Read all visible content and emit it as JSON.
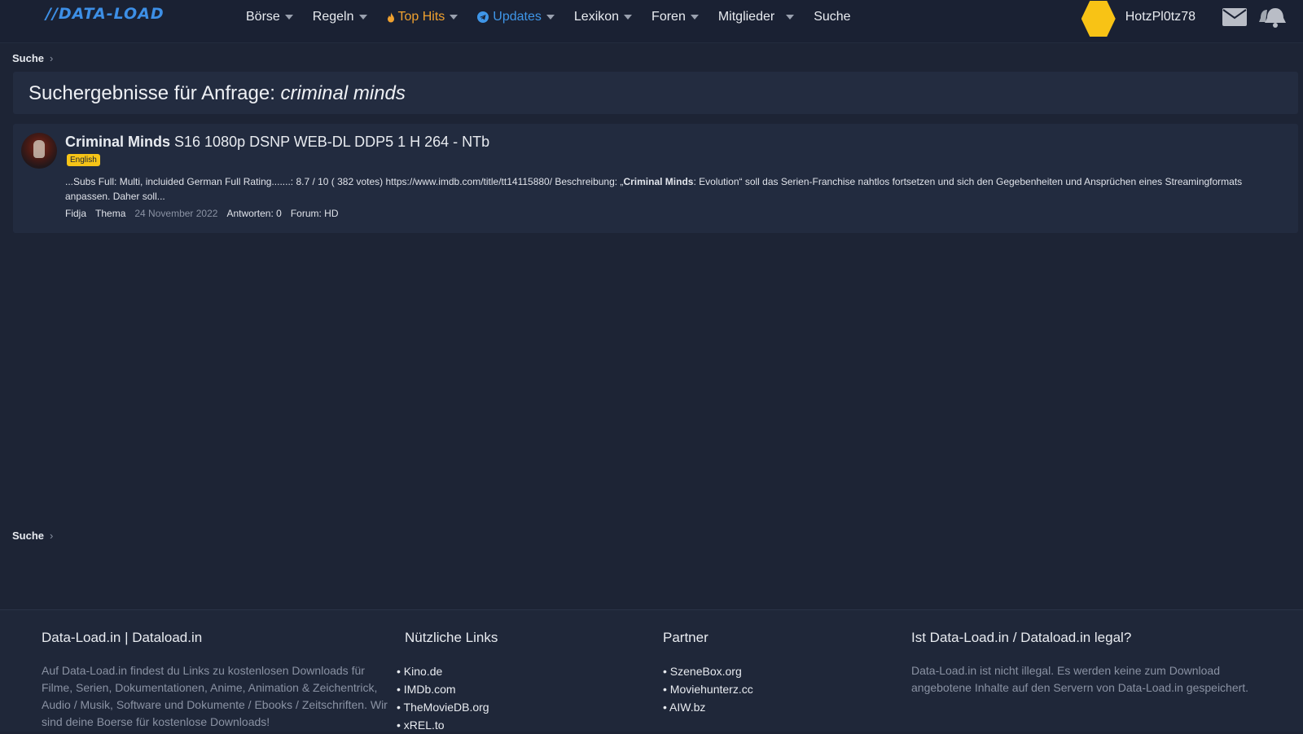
{
  "header": {
    "logo": "//DATA-LOAD",
    "nav": {
      "boerse": "Börse",
      "regeln": "Regeln",
      "top_hits": "Top Hits",
      "updates": "Updates",
      "lexikon": "Lexikon",
      "foren": "Foren",
      "mitglieder": "Mitglieder",
      "suche": "Suche"
    },
    "username": "HotzPl0tz78",
    "colors": {
      "top_hits": "#f0a12f",
      "updates": "#3f96e8",
      "avatar": "#f8c315"
    }
  },
  "breadcrumb": {
    "item": "Suche"
  },
  "search": {
    "prefix": "Suchergebnisse für Anfrage: ",
    "query": "criminal minds"
  },
  "result": {
    "title_bold": "Criminal Minds",
    "title_rest": " S16 1080p DSNP WEB-DL DDP5 1 H 264 - NTb",
    "label": "English",
    "snippet_before": "...Subs Full: Multi, incluided German Full Rating.......: 8.7 / 10 ( 382 votes) https://www.imdb.com/title/tt14115880/ Beschreibung: „",
    "snippet_bold": "Criminal Minds",
    "snippet_after": ": Evolution“ soll das Serien-Franchise nahtlos fortsetzen und sich den Gegebenheiten und Ansprüchen eines Streamingformats anpassen. Daher soll...",
    "author": "Fidja",
    "type": "Thema",
    "date": "24 November 2022",
    "answers": "Antworten: 0",
    "forum": "Forum: HD"
  },
  "footer": {
    "about": {
      "title": "Data-Load.in | Dataload.in",
      "text": "Auf Data-Load.in findest du Links zu kostenlosen Downloads für Filme, Serien, Dokumentationen, Anime, Animation & Zeichentrick, Audio / Musik, Software und Dokumente / Ebooks / Zeitschriften. Wir sind deine Boerse für kostenlose Downloads!"
    },
    "links": {
      "title": "Nützliche Links",
      "items": [
        "Kino.de",
        "IMDb.com",
        "TheMovieDB.org",
        "xREL.to"
      ]
    },
    "partner": {
      "title": "Partner",
      "items": [
        "SzeneBox.org",
        "Moviehunterz.cc",
        "AIW.bz"
      ]
    },
    "legal": {
      "title": "Ist Data-Load.in / Dataload.in legal?",
      "text": "Data-Load.in ist nicht illegal. Es werden keine zum Download angebotene Inhalte auf den Servern von Data-Load.in gespeichert."
    }
  }
}
